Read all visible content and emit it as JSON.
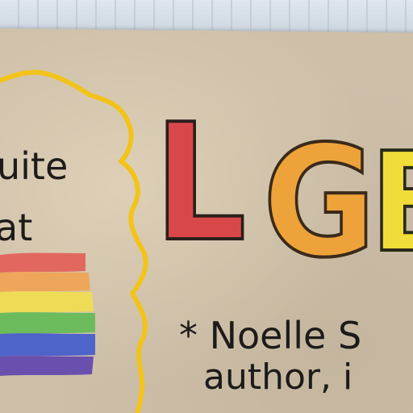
{
  "photo": {
    "left_text_line1": "uite",
    "left_text_line2": "at",
    "title_letters": [
      "L",
      "G",
      "B"
    ],
    "note_line1": "* Noelle S",
    "note_line2": "author, i"
  },
  "colors": {
    "paper": "#cdbfa8",
    "cloud_outline": "#f2c31a",
    "letter_L": "#d8484a",
    "letter_G": "#eea23a",
    "letter_B": "#f2dc3a",
    "rainbow": [
      "#e2685f",
      "#eea65a",
      "#eedc57",
      "#6cbb5c",
      "#4f64c8",
      "#6a4fae"
    ]
  }
}
